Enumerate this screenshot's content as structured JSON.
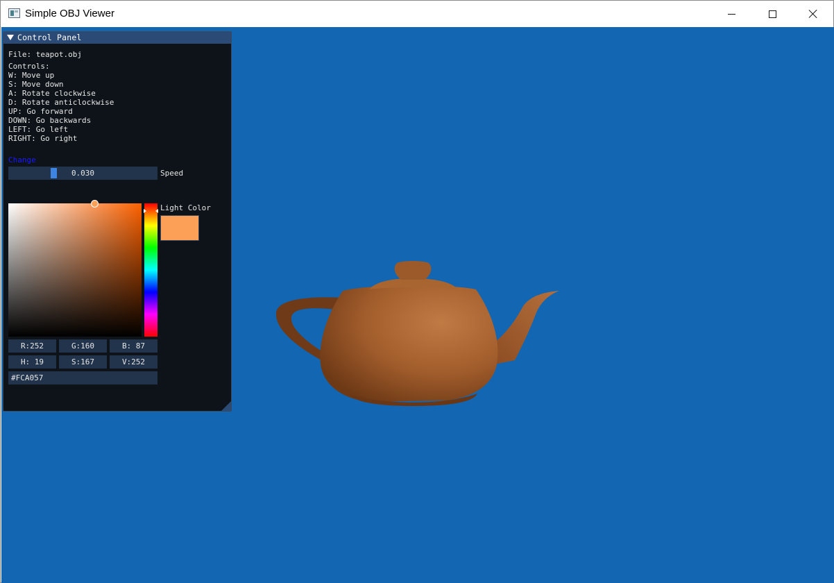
{
  "window": {
    "title": "Simple OBJ Viewer"
  },
  "panel": {
    "title": "Control Panel",
    "file_line": "File: teapot.obj",
    "controls_text": "Controls:\nW: Move up\nS: Move down\nA: Rotate clockwise\nD: Rotate anticlockwise\nUP: Go forward\nDOWN: Go backwards\nLEFT: Go left\nRIGHT: Go right",
    "change_label": "Change",
    "speed": {
      "value": "0.030",
      "label": "Speed"
    },
    "light_color": {
      "label": "Light Color",
      "r": "R:252",
      "g": "G:160",
      "b": "B: 87",
      "h": "H: 19",
      "s": "S:167",
      "v": "V:252",
      "hex": "#FCA057"
    }
  },
  "colors": {
    "viewport_bg": "#1266b2",
    "panel_bg": "#0d1318",
    "panel_header": "#2b4a75",
    "light_color": "#fca057",
    "change_link": "#1a1aff",
    "teapot": "#b06a38"
  },
  "icons": {
    "app": "app-window-icon",
    "collapse": "triangle-down-icon",
    "minimize": "minimize-icon",
    "maximize": "maximize-icon",
    "close": "close-icon"
  }
}
